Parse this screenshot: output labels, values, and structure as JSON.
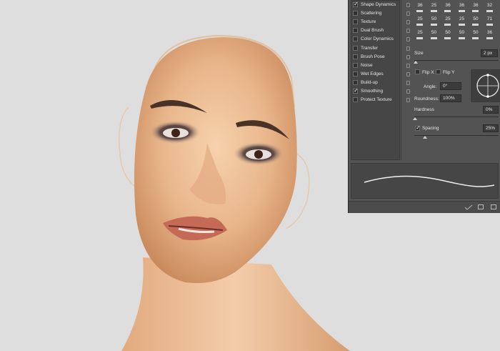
{
  "brush_tip_options": {
    "items": [
      {
        "label": "Shape Dynamics",
        "checked": true
      },
      {
        "label": "Scattering",
        "checked": false
      },
      {
        "label": "Texture",
        "checked": false
      },
      {
        "label": "Dual Brush",
        "checked": false
      },
      {
        "label": "Color Dynamics",
        "checked": false
      },
      {
        "label": "Transfer",
        "checked": false
      },
      {
        "label": "Brush Pose",
        "checked": false
      },
      {
        "label": "Noise",
        "checked": false
      },
      {
        "label": "Wet Edges",
        "checked": false
      },
      {
        "label": "Build-up",
        "checked": false
      },
      {
        "label": "Smoothing",
        "checked": true
      },
      {
        "label": "Protect Texture",
        "checked": false
      }
    ]
  },
  "presets": {
    "rows": [
      [
        "36",
        "25",
        "36",
        "36",
        "36",
        "32"
      ],
      [
        "25",
        "50",
        "25",
        "25",
        "50",
        "71"
      ],
      [
        "25",
        "50",
        "50",
        "50",
        "50",
        "36"
      ]
    ]
  },
  "settings": {
    "size_label": "Size",
    "size_value": "2 px",
    "flip_x_label": "Flip X",
    "flip_y_label": "Flip Y",
    "angle_label": "Angle:",
    "angle_value": "0°",
    "roundness_label": "Roundness:",
    "roundness_value": "100%",
    "hardness_label": "Hardness",
    "hardness_value": "0%",
    "spacing_label": "Spacing",
    "spacing_value": "25%",
    "spacing_checked": true
  },
  "colors": {
    "panel_bg": "#535353",
    "canvas_bg": "#dedede",
    "skin": "#e6b48a"
  }
}
